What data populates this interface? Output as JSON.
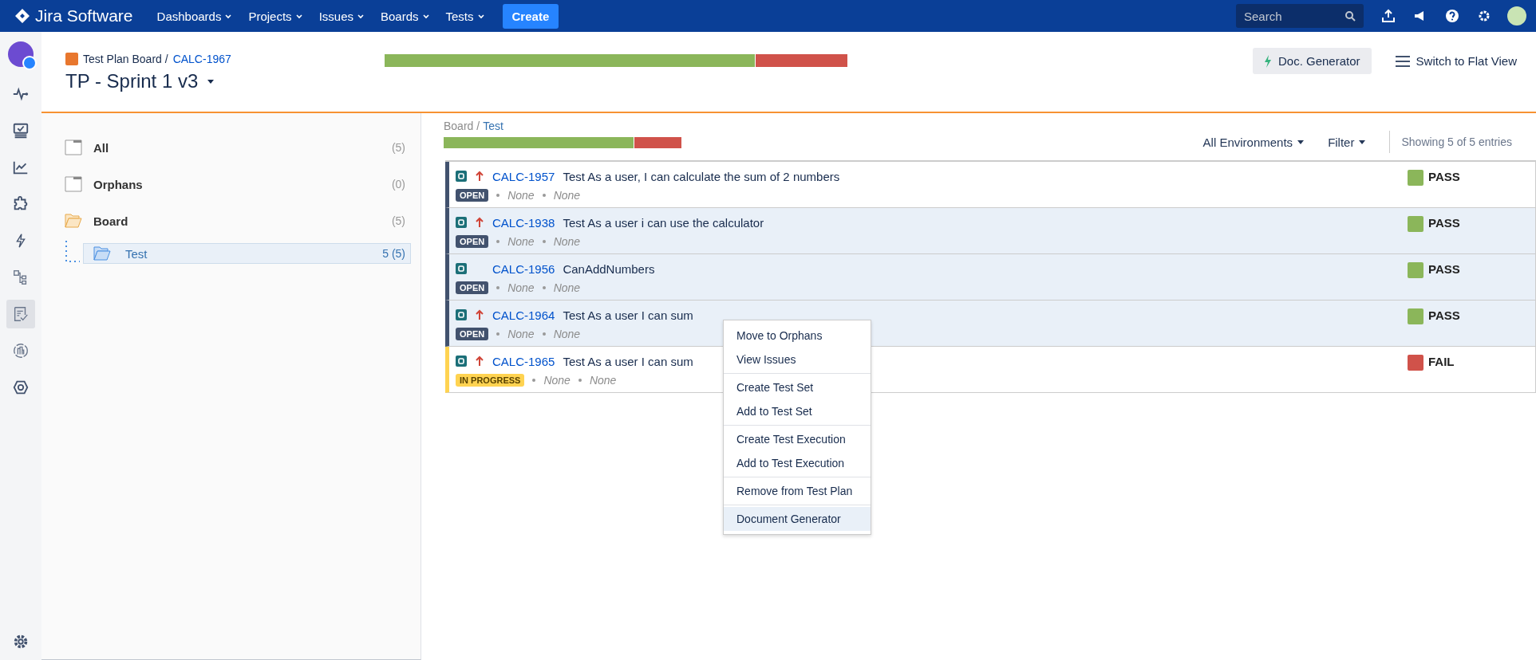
{
  "topbar": {
    "logo": "Jira Software",
    "nav": [
      {
        "label": "Dashboards"
      },
      {
        "label": "Projects"
      },
      {
        "label": "Issues"
      },
      {
        "label": "Boards"
      },
      {
        "label": "Tests"
      }
    ],
    "create": "Create",
    "search": {
      "placeholder": "Search"
    }
  },
  "rail": [
    {
      "kind": "activity",
      "selected": false
    },
    {
      "kind": "board",
      "selected": false
    },
    {
      "kind": "chart",
      "selected": false
    },
    {
      "kind": "puzzle",
      "selected": false
    },
    {
      "kind": "bolt",
      "selected": false
    },
    {
      "kind": "tree",
      "selected": false
    },
    {
      "kind": "plan",
      "selected": true
    },
    {
      "kind": "repo",
      "selected": false
    },
    {
      "kind": "hexagon",
      "selected": false
    }
  ],
  "header": {
    "breadcrumb": "Test Plan Board /",
    "issue_link": "CALC-1967",
    "title": "TP - Sprint 1 v3",
    "progress": {
      "level": 0.8
    },
    "doc_generator": "Doc. Generator",
    "flat_view": "Switch to Flat View"
  },
  "tree": [
    {
      "label": "All",
      "count": "(5)",
      "kind": "folder",
      "selected": false
    },
    {
      "label": "Orphans",
      "count": "(0)",
      "kind": "folder",
      "selected": false
    },
    {
      "label": "Board",
      "count": "(5)",
      "kind": "open-folder",
      "selected": false,
      "children": [
        {
          "label": "Test",
          "count": "5 (5)",
          "kind": "open-folder",
          "selected": true
        }
      ]
    }
  ],
  "board": {
    "breadcrumb": "Board /",
    "folder_link": "Test",
    "progress": {
      "level": 0.8
    },
    "environments": "All Environments",
    "filter": "Filter",
    "showing": "Showing 5 of 5 entries"
  },
  "tests": [
    {
      "key": "CALC-1957",
      "summary": "Test As a user, I can calculate the sum of 2 numbers",
      "status": "OPEN",
      "kind": "open",
      "high_priority": true,
      "field_1": "None",
      "field_2": "None",
      "result": "PASS",
      "color": "#8bb65a",
      "selected": false
    },
    {
      "key": "CALC-1938",
      "summary": "Test As a user i can use the calculator",
      "status": "OPEN",
      "kind": "open",
      "high_priority": true,
      "field_1": "None",
      "field_2": "None",
      "result": "PASS",
      "color": "#8bb65a",
      "selected": true
    },
    {
      "key": "CALC-1956",
      "summary": "CanAddNumbers",
      "status": "OPEN",
      "kind": "open",
      "high_priority": false,
      "field_1": "None",
      "field_2": "None",
      "result": "PASS",
      "color": "#8bb65a",
      "selected": true
    },
    {
      "key": "CALC-1964",
      "summary": "Test As a user I can sum",
      "status": "OPEN",
      "kind": "open",
      "high_priority": true,
      "field_1": "None",
      "field_2": "None",
      "result": "PASS",
      "color": "#8bb65a",
      "selected": true
    },
    {
      "key": "CALC-1965",
      "summary": "Test As a user I can sum",
      "status": "IN PROGRESS",
      "kind": "inprogress",
      "high_priority": true,
      "field_1": "None",
      "field_2": "None",
      "result": "FAIL",
      "color": "#d0524a",
      "selected": false
    }
  ],
  "context_menu": {
    "groups": [
      {
        "items": [
          {
            "label": "Move to Orphans",
            "selected": false
          },
          {
            "label": "View Issues",
            "selected": false
          }
        ]
      },
      {
        "items": [
          {
            "label": "Create Test Set",
            "selected": false
          },
          {
            "label": "Add to Test Set",
            "selected": false
          }
        ]
      },
      {
        "items": [
          {
            "label": "Create Test Execution",
            "selected": false
          },
          {
            "label": "Add to Test Execution",
            "selected": false
          }
        ]
      },
      {
        "items": [
          {
            "label": "Remove from Test Plan",
            "selected": false
          }
        ]
      },
      {
        "items": [
          {
            "label": "Document Generator",
            "selected": true
          }
        ]
      }
    ]
  }
}
